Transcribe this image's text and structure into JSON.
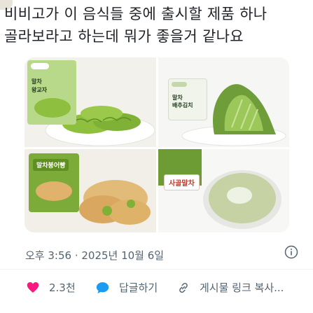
{
  "post": {
    "line1": "비비고가 이 음식들 중에 출시할 제품 하나",
    "line2": "골라보라고 하는데 뭐가 좋을거 같나요"
  },
  "images": {
    "product1": {
      "brand": "bibigo",
      "name_line1": "말차",
      "name_line2": "왕교자"
    },
    "product2": {
      "brand": "bibigo",
      "name_line1": "말차",
      "name_line2": "배추김치"
    },
    "product3": {
      "brand": "bibigo",
      "name": "말차붕어빵"
    },
    "product4": {
      "brand": "bibigo",
      "name": "사골말차"
    }
  },
  "meta": {
    "timestamp": "오후 3:56 · 2025년 10월 6일"
  },
  "actions": {
    "likes": "2.3천",
    "reply_label": "답글하기",
    "share_label": "게시물 링크 복사..."
  },
  "colors": {
    "like": "#f91880",
    "reply": "#1d9bf0",
    "matcha": "#7fae3a"
  }
}
